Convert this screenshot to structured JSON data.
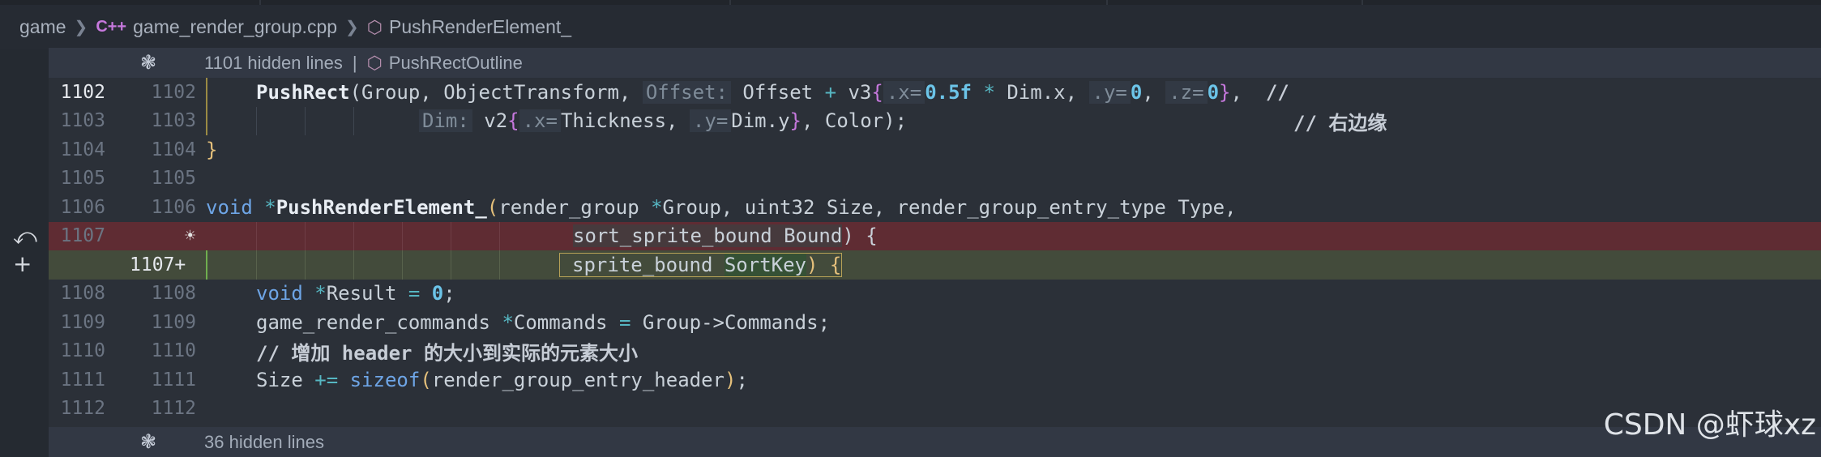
{
  "breadcrumb": {
    "root": "game",
    "file_badge": "C++",
    "file": "game_render_group.cpp",
    "symbol": "PushRenderElement_"
  },
  "folds": {
    "top": {
      "text": "1101 hidden lines",
      "pipe": "|",
      "symbol": "PushRectOutline"
    },
    "bottom": {
      "text": "36 hidden lines"
    }
  },
  "lines": {
    "l1102": {
      "left": "1102",
      "right": "1102"
    },
    "l1103": {
      "left": "1103",
      "right": "1103"
    },
    "l1104": {
      "left": "1104",
      "right": "1104"
    },
    "l1105": {
      "left": "1105",
      "right": "1105"
    },
    "l1106": {
      "left": "1106",
      "right": "1106"
    },
    "l1107a": {
      "left": "1107",
      "right": ""
    },
    "l1107b": {
      "left": "",
      "right": "1107+"
    },
    "l1108": {
      "left": "1108",
      "right": "1108"
    },
    "l1109": {
      "left": "1109",
      "right": "1109"
    },
    "l1110": {
      "left": "1110",
      "right": "1110"
    },
    "l1111": {
      "left": "1111",
      "right": "1111"
    },
    "l1112": {
      "left": "1112",
      "right": "1112"
    }
  },
  "code": {
    "c1102": {
      "fn": "PushRect",
      "p1": "(Group, ObjectTransform, ",
      "hint1": "Offset:",
      "p2": " Offset ",
      "op1": "+",
      "p3": " v3",
      "b1": "{",
      "hint2": ".x=",
      "num1": "0.5f",
      "op2": " * ",
      "p4": "Dim.x, ",
      "hint3": ".y=",
      "num2": "0",
      "p5": ", ",
      "hint4": ".z=",
      "num3": "0",
      "b2": "}",
      "p6": ",  ",
      "cm": "//"
    },
    "c1103": {
      "hint1": "Dim:",
      "p1": " v2",
      "b1": "{",
      "hint2": ".x=",
      "p2": "Thickness, ",
      "hint3": ".y=",
      "p3": "Dim.y",
      "b2": "}",
      "p4": ", Color);",
      "cm": "// 右边缘"
    },
    "c1104": {
      "brace": "}"
    },
    "c1106": {
      "kw": "void",
      "star": " *",
      "fn": "PushRenderElement_",
      "paren": "(",
      "p1": "render_group ",
      "star2": "*",
      "p2": "Group, uint32 Size, render_group_entry_type Type,"
    },
    "c1107a": {
      "param": "sort_sprite_bound Bound",
      "p1": ") {"
    },
    "c1107b": {
      "p1": "sprite_bound ",
      "param": "SortKey",
      "p2": ") {"
    },
    "c1108": {
      "kw": "void",
      "star": " *",
      "p1": "Result ",
      "op": "=",
      "num": " 0",
      "p2": ";"
    },
    "c1109": {
      "p1": "game_render_commands ",
      "star": "*",
      "p2": "Commands ",
      "op": "=",
      "p3": " Group->Commands;"
    },
    "c1110": {
      "cm": "// 增加 header 的大小到实际的元素大小"
    },
    "c1111": {
      "p1": "Size ",
      "op": "+=",
      "kw": " sizeof",
      "paren": "(",
      "p2": "render_group_entry_header",
      "paren2": ")",
      "p3": ";"
    }
  },
  "icons": {
    "fold": "unfold-icon",
    "symbol": "cube-icon",
    "revert": "undo-icon",
    "add": "plus-icon",
    "bulb": "lightbulb-icon"
  },
  "watermark": "CSDN @虾球xz"
}
